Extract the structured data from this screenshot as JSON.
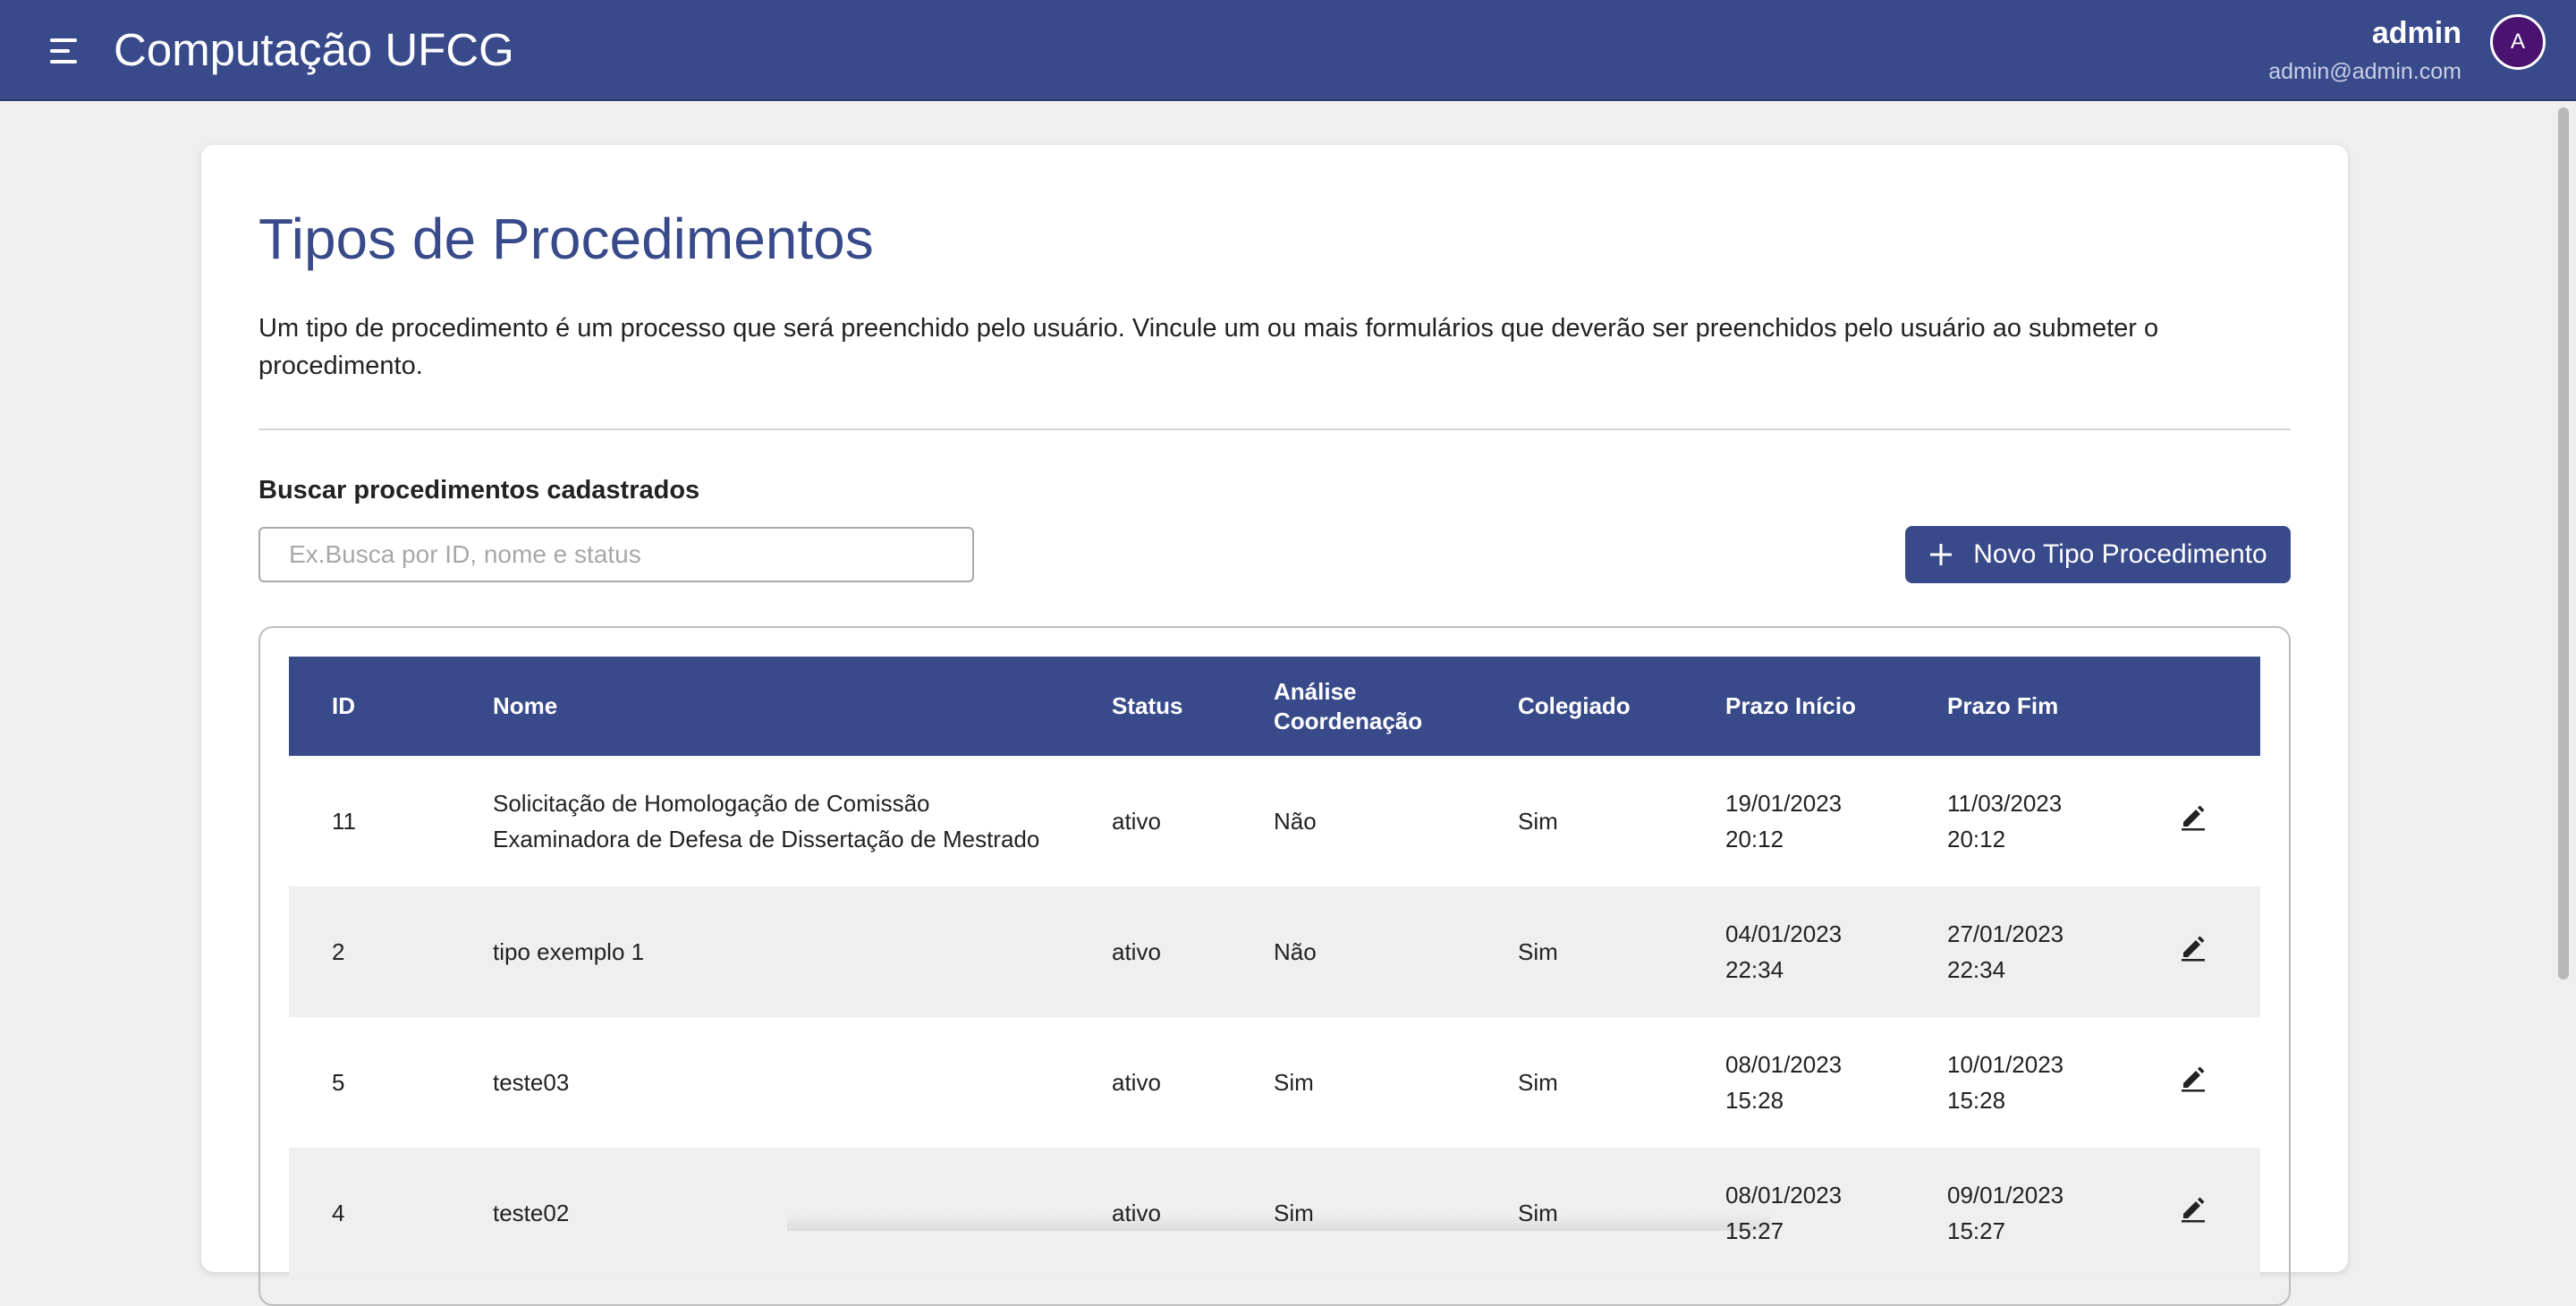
{
  "app": {
    "title": "Computação UFCG",
    "user_name": "admin",
    "user_email": "admin@admin.com",
    "avatar_letter": "A"
  },
  "page": {
    "title": "Tipos de Procedimentos",
    "description": "Um tipo de procedimento é um processo que será preenchido pelo usuário. Vincule um ou mais formulários que deverão ser preenchidos pelo usuário ao submeter o procedimento."
  },
  "search": {
    "label": "Buscar procedimentos cadastrados",
    "placeholder": "Ex.Busca por ID, nome e status",
    "value": ""
  },
  "new_button": {
    "label": "Novo Tipo Procedimento"
  },
  "table": {
    "headers": {
      "id": "ID",
      "nome": "Nome",
      "status": "Status",
      "analise_line1": "Análise",
      "analise_line2": "Coordenação",
      "colegiado": "Colegiado",
      "prazo_inicio": "Prazo Início",
      "prazo_fim": "Prazo Fim"
    },
    "rows": [
      {
        "id": "11",
        "nome_line1": "Solicitação de Homologação de Comissão",
        "nome_line2": "Examinadora de Defesa de Dissertação de Mestrado",
        "status": "ativo",
        "analise": "Não",
        "colegiado": "Sim",
        "inicio_date": "19/01/2023",
        "inicio_time": "20:12",
        "fim_date": "11/03/2023",
        "fim_time": "20:12"
      },
      {
        "id": "2",
        "nome_line1": "tipo exemplo 1",
        "nome_line2": "",
        "status": "ativo",
        "analise": "Não",
        "colegiado": "Sim",
        "inicio_date": "04/01/2023",
        "inicio_time": "22:34",
        "fim_date": "27/01/2023",
        "fim_time": "22:34"
      },
      {
        "id": "5",
        "nome_line1": "teste03",
        "nome_line2": "",
        "status": "ativo",
        "analise": "Sim",
        "colegiado": "Sim",
        "inicio_date": "08/01/2023",
        "inicio_time": "15:28",
        "fim_date": "10/01/2023",
        "fim_time": "15:28"
      },
      {
        "id": "4",
        "nome_line1": "teste02",
        "nome_line2": "",
        "status": "ativo",
        "analise": "Sim",
        "colegiado": "Sim",
        "inicio_date": "08/01/2023",
        "inicio_time": "15:27",
        "fim_date": "09/01/2023",
        "fim_time": "15:27"
      }
    ]
  },
  "colors": {
    "primary": "#394a8b",
    "avatar": "#4a1370",
    "row_alt": "#efefef"
  },
  "icons": {
    "menu": "menu-icon",
    "add": "plus-icon",
    "edit": "pencil-icon"
  }
}
